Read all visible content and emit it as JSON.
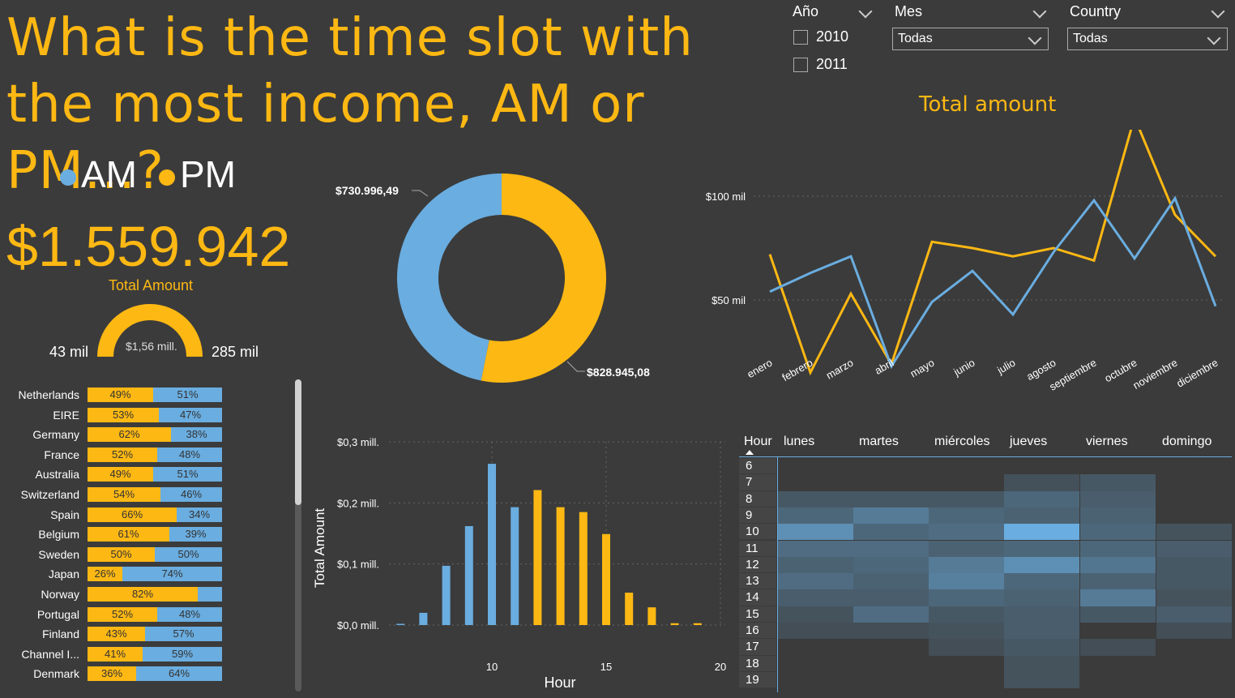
{
  "title": "What is the time slot with the most income, AM or PM...?",
  "slicers": {
    "year": {
      "label": "Año",
      "options": [
        "2010",
        "2011"
      ]
    },
    "month": {
      "label": "Mes",
      "value": "Todas"
    },
    "country": {
      "label": "Country",
      "value": "Todas"
    }
  },
  "legend": {
    "am": "AM",
    "pm": "PM"
  },
  "colors": {
    "am": "#6aade0",
    "pm": "#fdb813",
    "background": "#3b3b3b"
  },
  "kpi": {
    "value": "$1.559.942",
    "label": "Total Amount"
  },
  "gauge": {
    "min": "43 mil",
    "max": "285 mil",
    "center": "$1,56 mill."
  },
  "donut": {
    "am_label": "$730.996,49",
    "pm_label": "$828.945,08",
    "am_value": 730996.49,
    "pm_value": 828945.08
  },
  "line_chart": {
    "title": "Total amount",
    "y_ticks": [
      "$100 mil",
      "$50 mil"
    ],
    "months": [
      "enero",
      "febrero",
      "marzo",
      "abril",
      "mayo",
      "junio",
      "julio",
      "agosto",
      "septiembre",
      "octubre",
      "noviembre",
      "diciembre"
    ],
    "am": [
      54,
      63,
      71,
      18,
      49,
      64,
      43,
      73,
      98,
      70,
      99,
      47
    ],
    "pm": [
      72,
      15,
      53,
      19,
      78,
      75,
      71,
      75,
      69,
      138,
      91,
      71
    ]
  },
  "countries": [
    {
      "name": "Netherlands",
      "am": 49,
      "am_label": "49%",
      "pm_label": "51%"
    },
    {
      "name": "EIRE",
      "am": 53,
      "am_label": "53%",
      "pm_label": "47%"
    },
    {
      "name": "Germany",
      "am": 62,
      "am_label": "62%",
      "pm_label": "38%"
    },
    {
      "name": "France",
      "am": 52,
      "am_label": "52%",
      "pm_label": "48%"
    },
    {
      "name": "Australia",
      "am": 49,
      "am_label": "49%",
      "pm_label": "51%"
    },
    {
      "name": "Switzerland",
      "am": 54,
      "am_label": "54%",
      "pm_label": "46%"
    },
    {
      "name": "Spain",
      "am": 66,
      "am_label": "66%",
      "pm_label": "34%"
    },
    {
      "name": "Belgium",
      "am": 61,
      "am_label": "61%",
      "pm_label": "39%"
    },
    {
      "name": "Sweden",
      "am": 50,
      "am_label": "50%",
      "pm_label": "50%"
    },
    {
      "name": "Japan",
      "am": 26,
      "am_label": "26%",
      "pm_label": "74%"
    },
    {
      "name": "Norway",
      "am": 82,
      "am_label": "82%",
      "pm_label": ""
    },
    {
      "name": "Portugal",
      "am": 52,
      "am_label": "52%",
      "pm_label": "48%"
    },
    {
      "name": "Finland",
      "am": 43,
      "am_label": "43%",
      "pm_label": "57%"
    },
    {
      "name": "Channel I...",
      "am": 41,
      "am_label": "41%",
      "pm_label": "59%"
    },
    {
      "name": "Denmark",
      "am": 36,
      "am_label": "36%",
      "pm_label": "64%"
    }
  ],
  "chart_data": {
    "type": "bar",
    "xlabel": "Hour",
    "ylabel": "Total Amount",
    "y_ticks": [
      "$0,3 mill.",
      "$0,2 mill.",
      "$0,1 mill.",
      "$0,0 mill."
    ],
    "x_ticks": [
      "10",
      "15",
      "20"
    ],
    "ylim": [
      0,
      0.3
    ],
    "bars": [
      {
        "hour": 6,
        "value": 0.002,
        "slot": "am"
      },
      {
        "hour": 7,
        "value": 0.02,
        "slot": "am"
      },
      {
        "hour": 8,
        "value": 0.097,
        "slot": "am"
      },
      {
        "hour": 9,
        "value": 0.162,
        "slot": "am"
      },
      {
        "hour": 10,
        "value": 0.264,
        "slot": "am"
      },
      {
        "hour": 11,
        "value": 0.193,
        "slot": "am"
      },
      {
        "hour": 12,
        "value": 0.221,
        "slot": "pm"
      },
      {
        "hour": 13,
        "value": 0.193,
        "slot": "pm"
      },
      {
        "hour": 14,
        "value": 0.185,
        "slot": "pm"
      },
      {
        "hour": 15,
        "value": 0.149,
        "slot": "pm"
      },
      {
        "hour": 16,
        "value": 0.053,
        "slot": "pm"
      },
      {
        "hour": 17,
        "value": 0.029,
        "slot": "pm"
      },
      {
        "hour": 18,
        "value": 0.003,
        "slot": "pm"
      },
      {
        "hour": 19,
        "value": 0.003,
        "slot": "pm"
      }
    ]
  },
  "heatmap": {
    "hour_header": "Hour",
    "days": [
      "lunes",
      "martes",
      "miércoles",
      "jueves",
      "viernes",
      "domingo"
    ],
    "hours": [
      "6",
      "7",
      "8",
      "9",
      "10",
      "11",
      "12",
      "13",
      "14",
      "15",
      "16",
      "17",
      "18",
      "19"
    ],
    "intensity": [
      [
        0,
        0,
        0,
        0,
        0,
        0
      ],
      [
        0,
        0,
        0,
        0.08,
        0.15,
        0
      ],
      [
        0.15,
        0.15,
        0.15,
        0.3,
        0.2,
        0
      ],
      [
        0.3,
        0.5,
        0.3,
        0.25,
        0.25,
        0
      ],
      [
        0.7,
        0.3,
        0.35,
        1.0,
        0.3,
        0.1
      ],
      [
        0.35,
        0.35,
        0.25,
        0.3,
        0.3,
        0.2
      ],
      [
        0.25,
        0.3,
        0.5,
        0.7,
        0.45,
        0.15
      ],
      [
        0.35,
        0.25,
        0.55,
        0.3,
        0.25,
        0.15
      ],
      [
        0.2,
        0.2,
        0.3,
        0.25,
        0.5,
        0.1
      ],
      [
        0.1,
        0.35,
        0.15,
        0.2,
        0.15,
        0.2
      ],
      [
        0.05,
        0.05,
        0.1,
        0.2,
        0.0,
        0.05
      ],
      [
        0.0,
        0.0,
        0.05,
        0.15,
        0.05,
        0.0
      ],
      [
        0.0,
        0.0,
        0.0,
        0.1,
        0.0,
        0.0
      ],
      [
        0.0,
        0.0,
        0.0,
        0.1,
        0.0,
        0.0
      ]
    ]
  }
}
